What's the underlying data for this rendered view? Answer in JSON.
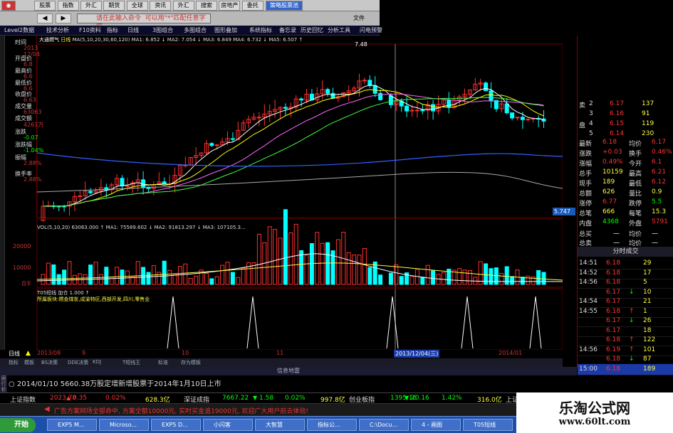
{
  "toolbar": {
    "buttons": [
      "股票",
      "指数",
      "外汇",
      "期货",
      "全球",
      "资讯",
      "外汇",
      "搜索",
      "房地产",
      "委托"
    ],
    "strategy": "策略股票池",
    "command_placeholder": "请在此输入命令",
    "command_hint": "可以用\"*\"匹配任意字符",
    "file_menu": "文件"
  },
  "menu": {
    "items": [
      "Level2数据",
      "技术分析",
      "F10资料",
      "指标",
      "日线",
      "3图组合",
      "多图组合",
      "图形叠加",
      "系统指标",
      "备忘录",
      "历史回忆",
      "分析工具",
      "闪电预警"
    ]
  },
  "stock": {
    "name": "大通燃气",
    "period": "日线",
    "ma_legend": "MA(5,10,20,30,60,120)  MA1: 6.852 ↓  MA2: 7.054 ↓  MA3: 6.849  MA4: 6.732 ↓  MA5: 6.507 ↑"
  },
  "info_panel": {
    "labels": [
      "时间",
      "开盘价",
      "最高价",
      "最低价",
      "收盘价",
      "成交量",
      "成交额",
      "涨跌",
      "涨跌幅",
      "振幅",
      "换手率"
    ],
    "values": [
      "2013\n12/04",
      "6.8",
      "6.6",
      "6.6",
      "6.63",
      "63063",
      "4261万",
      "-0.07",
      "-1.04%",
      "2.88%",
      "2.88%"
    ]
  },
  "chart_price": {
    "high_label": "7.48",
    "low_label": "5.747"
  },
  "volume": {
    "legend": "VOL(5,10,20)  63063.000 ↑  MA1: 75589.602 ↓  MA2: 91813.297 ↓  MA3: 107105.3...",
    "ticks": [
      "20000",
      "10000",
      "百手"
    ]
  },
  "signal": {
    "legend": "T05短线  加仓  1.000 ↑",
    "concepts": "所属板块:燃金煤炭,成渝特区,西部开发,四川,零售业"
  },
  "date_axis": {
    "left": "日线",
    "ticks": [
      "2013/08",
      "9",
      "10",
      "11",
      "2013/12/04(三)",
      "2014/01"
    ]
  },
  "bottom_tabs": [
    "指标",
    "模板",
    "BS决策",
    "DDE决策",
    "KDJ",
    "T短线王",
    "标准",
    "存为模板"
  ],
  "info_title": "信息地雷",
  "news": {
    "date_text": "2014/01/10  5660.38万股定增新增股票于2014年1月10日上市",
    "side_labels": [
      "届",
      "行",
      "析"
    ]
  },
  "index_bar": [
    {
      "name": "上证指数",
      "value": "2023.78",
      "change": "0.35",
      "pct": "0.02%",
      "amount": "628.3亿"
    },
    {
      "name": "深证成指",
      "value": "7667.22",
      "change": "1.58",
      "pct": "0.02%",
      "amount": "997.8亿"
    },
    {
      "name": "创业板指",
      "value": "1395.16",
      "change": "20.16",
      "pct": "1.42%",
      "amount": "316.0亿"
    },
    {
      "name": "上证",
      "value": "",
      "change": "",
      "pct": "",
      "amount": ""
    }
  ],
  "marquee": "广告方案网场全部命中, 方案全额10000元, 实时买金追19000元, 欢迎广大用户前去体验!",
  "taskbar": {
    "start": "开始",
    "tasks": [
      "EXP5 M...",
      "Microso...",
      "EXP5 D...",
      "小闪客",
      "大智慧",
      "指标公...",
      "C:\\Docu...",
      "4 - 画图",
      "T05短线"
    ]
  },
  "quote": {
    "asks": [
      {
        "label": "卖",
        "level": "2",
        "price": "6.17",
        "vol": "137"
      },
      {
        "label": "",
        "level": "3",
        "price": "6.16",
        "vol": "91"
      },
      {
        "label": "盘",
        "level": "4",
        "price": "6.15",
        "vol": "119"
      },
      {
        "label": "",
        "level": "5",
        "price": "6.14",
        "vol": "230"
      }
    ],
    "rows": [
      [
        "最新",
        "6.18",
        "均价",
        "6.17"
      ],
      [
        "涨跌",
        "+0.03",
        "换手",
        "0.46%"
      ],
      [
        "涨幅",
        "0.49%",
        "今开",
        "6.1"
      ],
      [
        "总手",
        "10159",
        "最高",
        "6.21"
      ],
      [
        "现手",
        "189",
        "最低",
        "6.12"
      ],
      [
        "总额",
        "626",
        "量比",
        "0.9"
      ],
      [
        "涨停",
        "6.77",
        "跌停",
        "5.5"
      ],
      [
        "总笔",
        "666",
        "每笔",
        "15.3"
      ],
      [
        "内盘",
        "4368",
        "外盘",
        "5791"
      ]
    ],
    "extra": [
      [
        "总买",
        "一",
        "均价",
        "一"
      ],
      [
        "总卖",
        "一",
        "均价",
        "一"
      ]
    ],
    "trade_header": "分时成交"
  },
  "trades": [
    [
      "14:51",
      "6.18",
      "",
      "29"
    ],
    [
      "14:52",
      "6.18",
      "",
      "17"
    ],
    [
      "14:56",
      "6.18",
      "",
      "5"
    ],
    [
      "",
      "6.17",
      "↓",
      "10"
    ],
    [
      "14:54",
      "6.17",
      "",
      "21"
    ],
    [
      "14:55",
      "6.18",
      "↑",
      "1"
    ],
    [
      "",
      "6.17",
      "↓",
      "26"
    ],
    [
      "",
      "6.17",
      "",
      "18"
    ],
    [
      "",
      "6.18",
      "↑",
      "122"
    ],
    [
      "14:56",
      "6.19",
      "↑",
      "101"
    ],
    [
      "",
      "6.18",
      "↓",
      "87"
    ],
    [
      "15:00",
      "6.18",
      "",
      "189"
    ]
  ],
  "watermark": {
    "title": "乐淘公式网",
    "url": "www.60lt.com"
  },
  "colors": {
    "up": "#ff3030",
    "down": "#00ffff",
    "ma_white": "#ffffff",
    "ma_yellow": "#ffff00",
    "ma_magenta": "#ff66ff",
    "ma_green": "#40ff40",
    "ma_blue": "#3060ff"
  }
}
